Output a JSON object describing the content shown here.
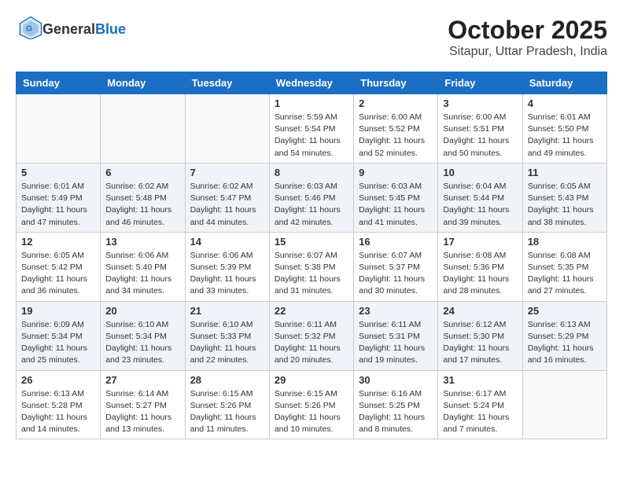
{
  "header": {
    "logo_general": "General",
    "logo_blue": "Blue",
    "title": "October 2025",
    "subtitle": "Sitapur, Uttar Pradesh, India"
  },
  "weekdays": [
    "Sunday",
    "Monday",
    "Tuesday",
    "Wednesday",
    "Thursday",
    "Friday",
    "Saturday"
  ],
  "weeks": [
    [
      {
        "day": "",
        "info": ""
      },
      {
        "day": "",
        "info": ""
      },
      {
        "day": "",
        "info": ""
      },
      {
        "day": "1",
        "info": "Sunrise: 5:59 AM\nSunset: 5:54 PM\nDaylight: 11 hours\nand 54 minutes."
      },
      {
        "day": "2",
        "info": "Sunrise: 6:00 AM\nSunset: 5:52 PM\nDaylight: 11 hours\nand 52 minutes."
      },
      {
        "day": "3",
        "info": "Sunrise: 6:00 AM\nSunset: 5:51 PM\nDaylight: 11 hours\nand 50 minutes."
      },
      {
        "day": "4",
        "info": "Sunrise: 6:01 AM\nSunset: 5:50 PM\nDaylight: 11 hours\nand 49 minutes."
      }
    ],
    [
      {
        "day": "5",
        "info": "Sunrise: 6:01 AM\nSunset: 5:49 PM\nDaylight: 11 hours\nand 47 minutes."
      },
      {
        "day": "6",
        "info": "Sunrise: 6:02 AM\nSunset: 5:48 PM\nDaylight: 11 hours\nand 46 minutes."
      },
      {
        "day": "7",
        "info": "Sunrise: 6:02 AM\nSunset: 5:47 PM\nDaylight: 11 hours\nand 44 minutes."
      },
      {
        "day": "8",
        "info": "Sunrise: 6:03 AM\nSunset: 5:46 PM\nDaylight: 11 hours\nand 42 minutes."
      },
      {
        "day": "9",
        "info": "Sunrise: 6:03 AM\nSunset: 5:45 PM\nDaylight: 11 hours\nand 41 minutes."
      },
      {
        "day": "10",
        "info": "Sunrise: 6:04 AM\nSunset: 5:44 PM\nDaylight: 11 hours\nand 39 minutes."
      },
      {
        "day": "11",
        "info": "Sunrise: 6:05 AM\nSunset: 5:43 PM\nDaylight: 11 hours\nand 38 minutes."
      }
    ],
    [
      {
        "day": "12",
        "info": "Sunrise: 6:05 AM\nSunset: 5:42 PM\nDaylight: 11 hours\nand 36 minutes."
      },
      {
        "day": "13",
        "info": "Sunrise: 6:06 AM\nSunset: 5:40 PM\nDaylight: 11 hours\nand 34 minutes."
      },
      {
        "day": "14",
        "info": "Sunrise: 6:06 AM\nSunset: 5:39 PM\nDaylight: 11 hours\nand 33 minutes."
      },
      {
        "day": "15",
        "info": "Sunrise: 6:07 AM\nSunset: 5:38 PM\nDaylight: 11 hours\nand 31 minutes."
      },
      {
        "day": "16",
        "info": "Sunrise: 6:07 AM\nSunset: 5:37 PM\nDaylight: 11 hours\nand 30 minutes."
      },
      {
        "day": "17",
        "info": "Sunrise: 6:08 AM\nSunset: 5:36 PM\nDaylight: 11 hours\nand 28 minutes."
      },
      {
        "day": "18",
        "info": "Sunrise: 6:08 AM\nSunset: 5:35 PM\nDaylight: 11 hours\nand 27 minutes."
      }
    ],
    [
      {
        "day": "19",
        "info": "Sunrise: 6:09 AM\nSunset: 5:34 PM\nDaylight: 11 hours\nand 25 minutes."
      },
      {
        "day": "20",
        "info": "Sunrise: 6:10 AM\nSunset: 5:34 PM\nDaylight: 11 hours\nand 23 minutes."
      },
      {
        "day": "21",
        "info": "Sunrise: 6:10 AM\nSunset: 5:33 PM\nDaylight: 11 hours\nand 22 minutes."
      },
      {
        "day": "22",
        "info": "Sunrise: 6:11 AM\nSunset: 5:32 PM\nDaylight: 11 hours\nand 20 minutes."
      },
      {
        "day": "23",
        "info": "Sunrise: 6:11 AM\nSunset: 5:31 PM\nDaylight: 11 hours\nand 19 minutes."
      },
      {
        "day": "24",
        "info": "Sunrise: 6:12 AM\nSunset: 5:30 PM\nDaylight: 11 hours\nand 17 minutes."
      },
      {
        "day": "25",
        "info": "Sunrise: 6:13 AM\nSunset: 5:29 PM\nDaylight: 11 hours\nand 16 minutes."
      }
    ],
    [
      {
        "day": "26",
        "info": "Sunrise: 6:13 AM\nSunset: 5:28 PM\nDaylight: 11 hours\nand 14 minutes."
      },
      {
        "day": "27",
        "info": "Sunrise: 6:14 AM\nSunset: 5:27 PM\nDaylight: 11 hours\nand 13 minutes."
      },
      {
        "day": "28",
        "info": "Sunrise: 6:15 AM\nSunset: 5:26 PM\nDaylight: 11 hours\nand 11 minutes."
      },
      {
        "day": "29",
        "info": "Sunrise: 6:15 AM\nSunset: 5:26 PM\nDaylight: 11 hours\nand 10 minutes."
      },
      {
        "day": "30",
        "info": "Sunrise: 6:16 AM\nSunset: 5:25 PM\nDaylight: 11 hours\nand 8 minutes."
      },
      {
        "day": "31",
        "info": "Sunrise: 6:17 AM\nSunset: 5:24 PM\nDaylight: 11 hours\nand 7 minutes."
      },
      {
        "day": "",
        "info": ""
      }
    ]
  ]
}
